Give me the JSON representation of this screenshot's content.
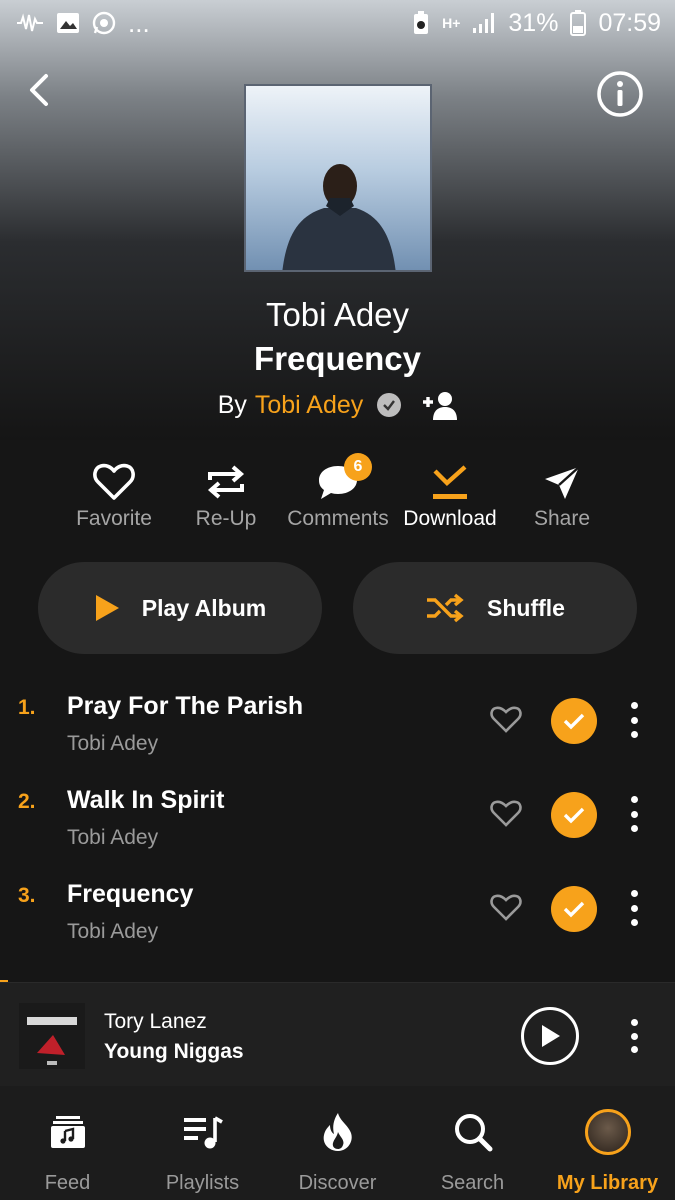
{
  "status_bar": {
    "dots": "...",
    "network": "H+",
    "battery": "31%",
    "time": "07:59"
  },
  "album": {
    "artist": "Tobi Adey",
    "title": "Frequency",
    "by_prefix": "By",
    "by_artist": "Tobi Adey"
  },
  "actions": [
    {
      "label": "Favorite",
      "icon": "heart-icon"
    },
    {
      "label": "Re-Up",
      "icon": "repeat-icon"
    },
    {
      "label": "Comments",
      "icon": "comment-icon",
      "badge": "6"
    },
    {
      "label": "Download",
      "icon": "download-icon"
    },
    {
      "label": "Share",
      "icon": "share-icon"
    }
  ],
  "buttons": {
    "play_album": "Play Album",
    "shuffle": "Shuffle"
  },
  "tracks": [
    {
      "num": "1.",
      "title": "Pray For The Parish",
      "artist": "Tobi Adey"
    },
    {
      "num": "2.",
      "title": "Walk In Spirit",
      "artist": "Tobi Adey"
    },
    {
      "num": "3.",
      "title": "Frequency",
      "artist": "Tobi Adey"
    }
  ],
  "now_playing": {
    "artist": "Tory Lanez",
    "title": "Young Niggas"
  },
  "tabs": [
    {
      "label": "Feed",
      "icon": "feed-icon"
    },
    {
      "label": "Playlists",
      "icon": "playlists-icon"
    },
    {
      "label": "Discover",
      "icon": "fire-icon"
    },
    {
      "label": "Search",
      "icon": "search-icon"
    },
    {
      "label": "My Library",
      "icon": "avatar"
    }
  ],
  "colors": {
    "accent": "#f7a21b",
    "background": "#161616",
    "button": "#2b2b2b"
  }
}
